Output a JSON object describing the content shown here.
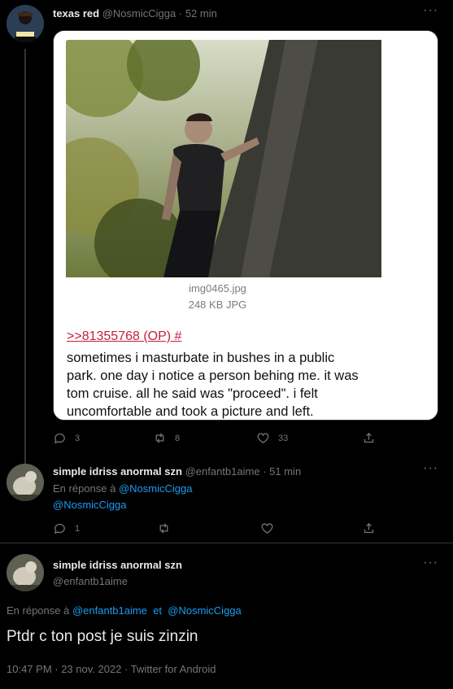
{
  "tweet1": {
    "name": "texas red",
    "handle": "@NosmicCigga",
    "sep": "·",
    "time": "52 min",
    "image_caption_file": "img0465.jpg",
    "image_caption_size": "248 KB JPG",
    "image_quote_link": ">>81355768 (OP) #",
    "image_text_lines": [
      "sometimes i masturbate in bushes in a public",
      "park. one day i notice a person behing me. it was",
      "tom cruise. all he said was \"proceed\". i felt",
      "uncomfortable and took a picture and left."
    ],
    "replies": "3",
    "retweets": "8",
    "likes": "33"
  },
  "tweet2": {
    "name": "simple idriss anormal szn",
    "handle": "@enfantb1aime",
    "sep": "·",
    "time": "51 min",
    "reply_prefix": "En réponse à",
    "reply_target_1": "@NosmicCigga",
    "reply_target_2": "@NosmicCigga",
    "replies": "1"
  },
  "tweet3": {
    "name": "simple idriss anormal szn",
    "handle": "@enfantb1aime",
    "reply_prefix": "En réponse à",
    "reply_target_1": "@enfantb1aime",
    "reply_and": "et",
    "reply_target_2": "@NosmicCigga",
    "text": "Ptdr c ton post je suis zinzin",
    "timestamp": "10:47 PM · 23 nov. 2022 · Twitter for Android"
  },
  "more_label": "···",
  "colors": {
    "background": "#000000",
    "text": "#e7e9ea",
    "muted": "#71767b",
    "link": "#1d9bf0",
    "quote_link": "#c41e3a"
  }
}
